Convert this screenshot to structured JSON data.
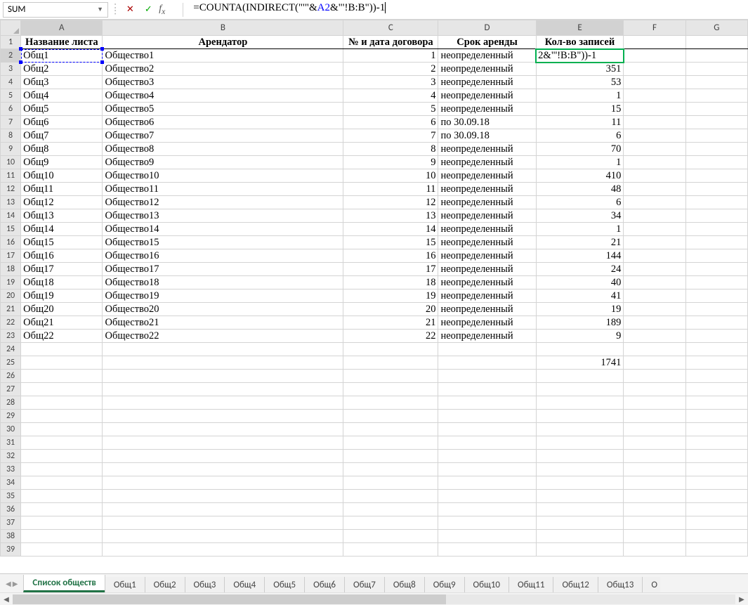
{
  "namebox_value": "SUM",
  "formula_display_prefix": "=COUNTA(INDIRECT(\"'\"&",
  "formula_display_ref": "A2",
  "formula_display_suffix": "&\"'!B:B\"))-1",
  "active_cell_display": "2&\"'!B:B\"))-1",
  "columns": [
    "A",
    "B",
    "C",
    "D",
    "E",
    "F",
    "G"
  ],
  "col_widths": [
    "col-A",
    "col-B",
    "col-C",
    "col-D",
    "col-E",
    "col-F",
    "col-G"
  ],
  "headers": {
    "A": "Название листа",
    "B": "Арендатор",
    "C": "№ и дата договора",
    "D": "Срок аренды",
    "E": "Кол-во записей"
  },
  "rows": [
    {
      "n": 2,
      "A": "Общ1",
      "B": "Общество1",
      "C": "1",
      "D": "неопределенный",
      "E": "__EDIT__"
    },
    {
      "n": 3,
      "A": "Общ2",
      "B": "Общество2",
      "C": "2",
      "D": "неопределенный",
      "E": "351"
    },
    {
      "n": 4,
      "A": "Общ3",
      "B": "Общество3",
      "C": "3",
      "D": "неопределенный",
      "E": "53"
    },
    {
      "n": 5,
      "A": "Общ4",
      "B": "Общество4",
      "C": "4",
      "D": "неопределенный",
      "E": "1"
    },
    {
      "n": 6,
      "A": "Общ5",
      "B": "Общество5",
      "C": "5",
      "D": "неопределенный",
      "E": "15"
    },
    {
      "n": 7,
      "A": "Общ6",
      "B": "Общество6",
      "C": "6",
      "D": "по 30.09.18",
      "E": "11"
    },
    {
      "n": 8,
      "A": "Общ7",
      "B": "Общество7",
      "C": "7",
      "D": "по 30.09.18",
      "E": "6"
    },
    {
      "n": 9,
      "A": "Общ8",
      "B": "Общество8",
      "C": "8",
      "D": "неопределенный",
      "E": "70"
    },
    {
      "n": 10,
      "A": "Общ9",
      "B": "Общество9",
      "C": "9",
      "D": "неопределенный",
      "E": "1"
    },
    {
      "n": 11,
      "A": "Общ10",
      "B": "Общество10",
      "C": "10",
      "D": "неопределенный",
      "E": "410"
    },
    {
      "n": 12,
      "A": "Общ11",
      "B": "Общество11",
      "C": "11",
      "D": "неопределенный",
      "E": "48"
    },
    {
      "n": 13,
      "A": "Общ12",
      "B": "Общество12",
      "C": "12",
      "D": "неопределенный",
      "E": "6"
    },
    {
      "n": 14,
      "A": "Общ13",
      "B": "Общество13",
      "C": "13",
      "D": "неопределенный",
      "E": "34"
    },
    {
      "n": 15,
      "A": "Общ14",
      "B": "Общество14",
      "C": "14",
      "D": "неопределенный",
      "E": "1"
    },
    {
      "n": 16,
      "A": "Общ15",
      "B": "Общество15",
      "C": "15",
      "D": "неопределенный",
      "E": "21"
    },
    {
      "n": 17,
      "A": "Общ16",
      "B": "Общество16",
      "C": "16",
      "D": "неопределенный",
      "E": "144"
    },
    {
      "n": 18,
      "A": "Общ17",
      "B": "Общество17",
      "C": "17",
      "D": "неопределенный",
      "E": "24"
    },
    {
      "n": 19,
      "A": "Общ18",
      "B": "Общество18",
      "C": "18",
      "D": "неопределенный",
      "E": "40"
    },
    {
      "n": 20,
      "A": "Общ19",
      "B": "Общество19",
      "C": "19",
      "D": "неопределенный",
      "E": "41"
    },
    {
      "n": 21,
      "A": "Общ20",
      "B": "Общество20",
      "C": "20",
      "D": "неопределенный",
      "E": "19"
    },
    {
      "n": 22,
      "A": "Общ21",
      "B": "Общество21",
      "C": "21",
      "D": "неопределенный",
      "E": "189"
    },
    {
      "n": 23,
      "A": "Общ22",
      "B": "Общество22",
      "C": "22",
      "D": "неопределенный",
      "E": "9"
    },
    {
      "n": 24
    },
    {
      "n": 25,
      "E": "1741"
    },
    {
      "n": 26
    },
    {
      "n": 27
    },
    {
      "n": 28
    },
    {
      "n": 29
    },
    {
      "n": 30
    },
    {
      "n": 31
    },
    {
      "n": 32
    },
    {
      "n": 33
    },
    {
      "n": 34
    },
    {
      "n": 35
    },
    {
      "n": 36
    },
    {
      "n": 37
    },
    {
      "n": 38
    },
    {
      "n": 39
    }
  ],
  "active_tab": "Список обществ",
  "tabs": [
    "Список обществ",
    "Общ1",
    "Общ2",
    "Общ3",
    "Общ4",
    "Общ5",
    "Общ6",
    "Общ7",
    "Общ8",
    "Общ9",
    "Общ10",
    "Общ11",
    "Общ12",
    "Общ13",
    "О"
  ]
}
